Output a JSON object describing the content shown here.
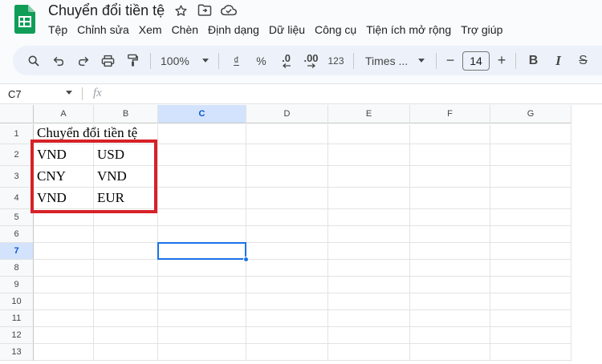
{
  "app": {
    "doc_title": "Chuyển đổi tiền tệ",
    "menu": [
      "Tệp",
      "Chỉnh sửa",
      "Xem",
      "Chèn",
      "Định dạng",
      "Dữ liệu",
      "Công cụ",
      "Tiện ích mở rộng",
      "Trợ giúp"
    ]
  },
  "toolbar": {
    "zoom": "100%",
    "currency_symbol": "₫",
    "percent": "%",
    "dec_decrease": ".0",
    "dec_increase": ".00",
    "number_format": "123",
    "font": "Times ...",
    "font_size": "14",
    "minus": "−",
    "plus": "+",
    "bold": "B",
    "italic": "I",
    "strike": "S"
  },
  "formula_bar": {
    "cell_ref": "C7",
    "fx": "fx",
    "value": ""
  },
  "sheet": {
    "columns": [
      "A",
      "B",
      "C",
      "D",
      "E",
      "F",
      "G"
    ],
    "rows": [
      "1",
      "2",
      "3",
      "4",
      "5",
      "6",
      "7",
      "8",
      "9",
      "10",
      "11",
      "12",
      "13"
    ],
    "cells": {
      "A1": "Chuyển đổi tiền tệ",
      "A2": "VND",
      "B2": "USD",
      "A3": "CNY",
      "B3": "VND",
      "A4": "VND",
      "B4": "EUR"
    },
    "selected_column": "C",
    "selected_row": "7"
  },
  "colors": {
    "accent": "#1a73e8",
    "highlight_box": "#d72128",
    "logo_green": "#0f9d58"
  }
}
